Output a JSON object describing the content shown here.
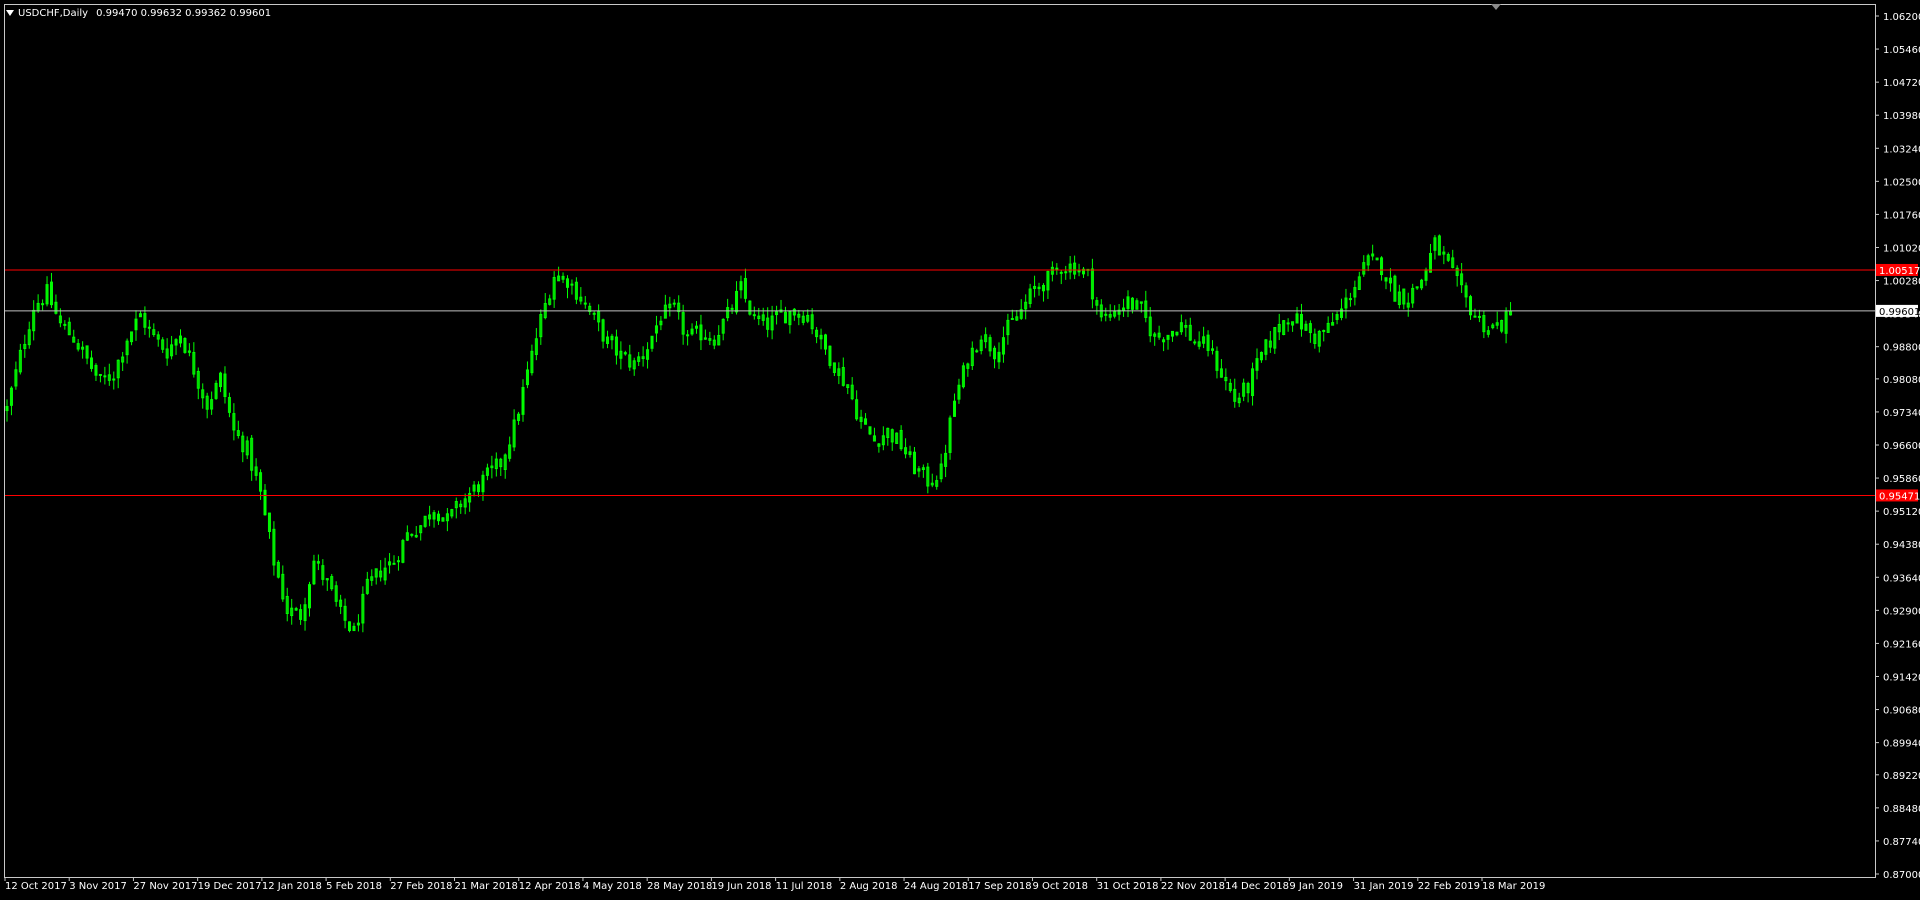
{
  "header": {
    "symbol_timeframe": "USDCHF,Daily",
    "ohlc": "0.99470 0.99632 0.99362 0.99601"
  },
  "colors": {
    "background": "#000000",
    "candle": "#00ff00",
    "support_resistance": "#ff0000",
    "bid_line": "#c0c0c0",
    "axis_text": "#ffffff",
    "frame": "#c8c8c8"
  },
  "chart_data": {
    "type": "candlestick",
    "symbol": "USDCHF",
    "timeframe": "Daily",
    "ylim": [
      0.87,
      1.062
    ],
    "y_ticks": [
      "1.06200",
      "1.05460",
      "1.04720",
      "1.03980",
      "1.03240",
      "1.02500",
      "1.01760",
      "1.01020",
      "1.00280",
      "0.99540",
      "0.98800",
      "0.98080",
      "0.97340",
      "0.96600",
      "0.95860",
      "0.95120",
      "0.94380",
      "0.93640",
      "0.92900",
      "0.92160",
      "0.91420",
      "0.90680",
      "0.89940",
      "0.89220",
      "0.88480",
      "0.87740",
      "0.87000"
    ],
    "x_ticks": [
      "12 Oct 2017",
      "3 Nov 2017",
      "27 Nov 2017",
      "19 Dec 2017",
      "12 Jan 2018",
      "5 Feb 2018",
      "27 Feb 2018",
      "21 Mar 2018",
      "12 Apr 2018",
      "4 May 2018",
      "28 May 2018",
      "19 Jun 2018",
      "11 Jul 2018",
      "2 Aug 2018",
      "24 Aug 2018",
      "17 Sep 2018",
      "9 Oct 2018",
      "31 Oct 2018",
      "22 Nov 2018",
      "14 Dec 2018",
      "9 Jan 2019",
      "31 Jan 2019",
      "22 Feb 2019",
      "18 Mar 2019"
    ],
    "close_path": [
      0.974,
      0.986,
      0.997,
      1.0,
      0.993,
      0.99,
      0.985,
      0.98,
      0.982,
      0.99,
      0.995,
      0.99,
      0.987,
      0.991,
      0.983,
      0.975,
      0.981,
      0.969,
      0.965,
      0.955,
      0.94,
      0.929,
      0.928,
      0.94,
      0.935,
      0.928,
      0.924,
      0.934,
      0.938,
      0.94,
      0.946,
      0.948,
      0.952,
      0.949,
      0.953,
      0.956,
      0.959,
      0.962,
      0.97,
      0.982,
      0.994,
      1.004,
      1.003,
      0.999,
      0.994,
      0.989,
      0.986,
      0.984,
      0.988,
      0.995,
      0.996,
      0.99,
      0.991,
      0.99,
      0.995,
      1.001,
      0.994,
      0.993,
      0.995,
      0.996,
      0.995,
      0.989,
      0.984,
      0.979,
      0.971,
      0.967,
      0.969,
      0.966,
      0.961,
      0.958,
      0.96,
      0.976,
      0.985,
      0.991,
      0.987,
      0.992,
      0.996,
      1.001,
      1.003,
      1.006,
      1.006,
      1.004,
      0.994,
      0.996,
      0.998,
      0.996,
      0.99,
      0.991,
      0.993,
      0.989,
      0.988,
      0.982,
      0.976,
      0.979,
      0.986,
      0.991,
      0.995,
      0.993,
      0.99,
      0.992,
      0.996,
      1.002,
      1.007,
      1.006,
      1.0,
      0.999,
      1.003,
      1.011,
      1.006,
      1.0,
      0.995,
      0.992,
      0.993,
      0.996
    ],
    "levels": [
      {
        "price": 1.00517,
        "label": "1.00517",
        "color": "#ff0000"
      },
      {
        "price": 0.99601,
        "label": "0.99601",
        "color": "#c0c0c0"
      },
      {
        "price": 0.95471,
        "label": "0.95471",
        "color": "#ff0000"
      }
    ]
  }
}
